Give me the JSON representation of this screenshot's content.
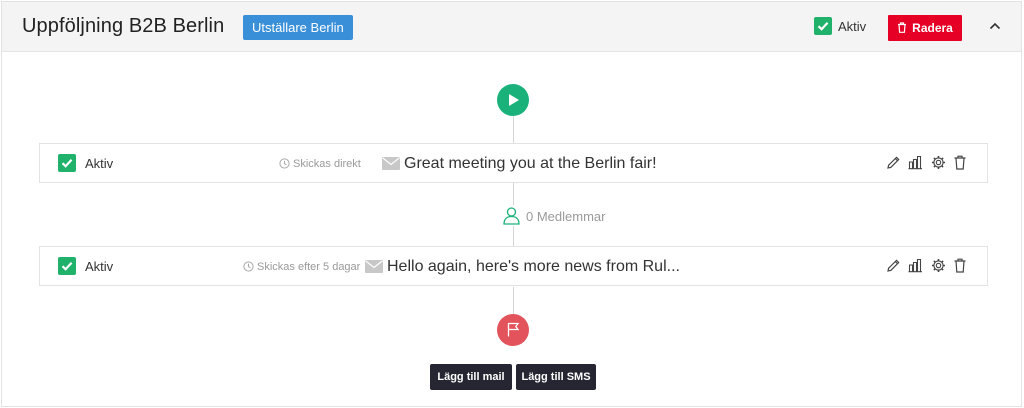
{
  "header": {
    "title": "Uppföljning B2B Berlin",
    "tag": "Utställare Berlin",
    "active_label": "Aktiv",
    "delete_label": "Radera"
  },
  "steps": [
    {
      "active_label": "Aktiv",
      "timing": "Skickas direkt",
      "subject": "Great meeting you at the Berlin fair!"
    },
    {
      "active_label": "Aktiv",
      "timing": "Skickas efter 5 dagar",
      "subject": "Hello again, here's more news from Rul..."
    }
  ],
  "members": {
    "label": "0 Medlemmar"
  },
  "actions": {
    "add_mail": "Lägg till mail",
    "add_sms": "Lägg till SMS"
  },
  "colors": {
    "active_green": "#20b26b",
    "start_green": "#1ab27a",
    "end_red": "#e2535b",
    "delete_red": "#e60026",
    "tag_blue": "#3a8fd9",
    "button_dark": "#262633"
  },
  "icons": [
    "check-icon",
    "trash-icon",
    "chevron-up-icon",
    "play-icon",
    "clock-icon",
    "envelope-icon",
    "pencil-icon",
    "stats-icon",
    "gear-icon",
    "user-icon",
    "flag-icon"
  ]
}
